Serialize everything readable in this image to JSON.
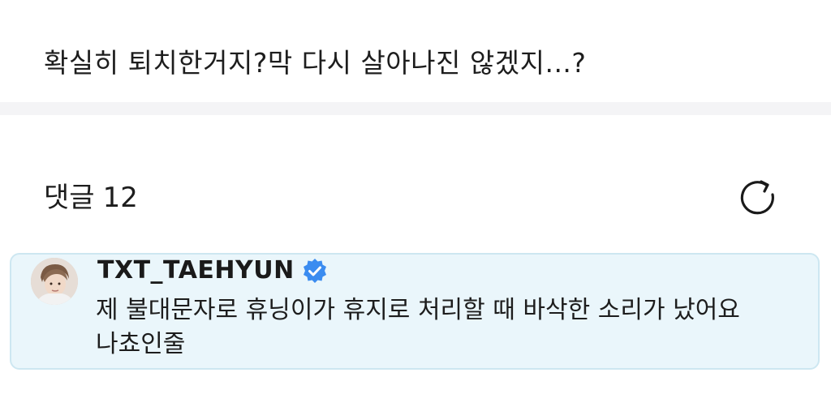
{
  "post": {
    "text": "확실히 퇴치한거지?막 다시 살아나진 않겠지...?"
  },
  "comments": {
    "title": "댓글",
    "count": "12",
    "refresh_icon": "refresh-icon",
    "items": [
      {
        "author": "TXT_TAEHYUN",
        "verified": true,
        "avatar_icon": "avatar",
        "lines": [
          "제 불대문자로 휴닝이가 휴지로 처리할 때 바삭한 소리가 났어요",
          "나쵸인줄"
        ]
      }
    ]
  },
  "colors": {
    "card_bg": "#eaf6fb",
    "card_border": "#cde7f1",
    "divider": "#f4f4f6",
    "verified": "#3b8cf0"
  }
}
